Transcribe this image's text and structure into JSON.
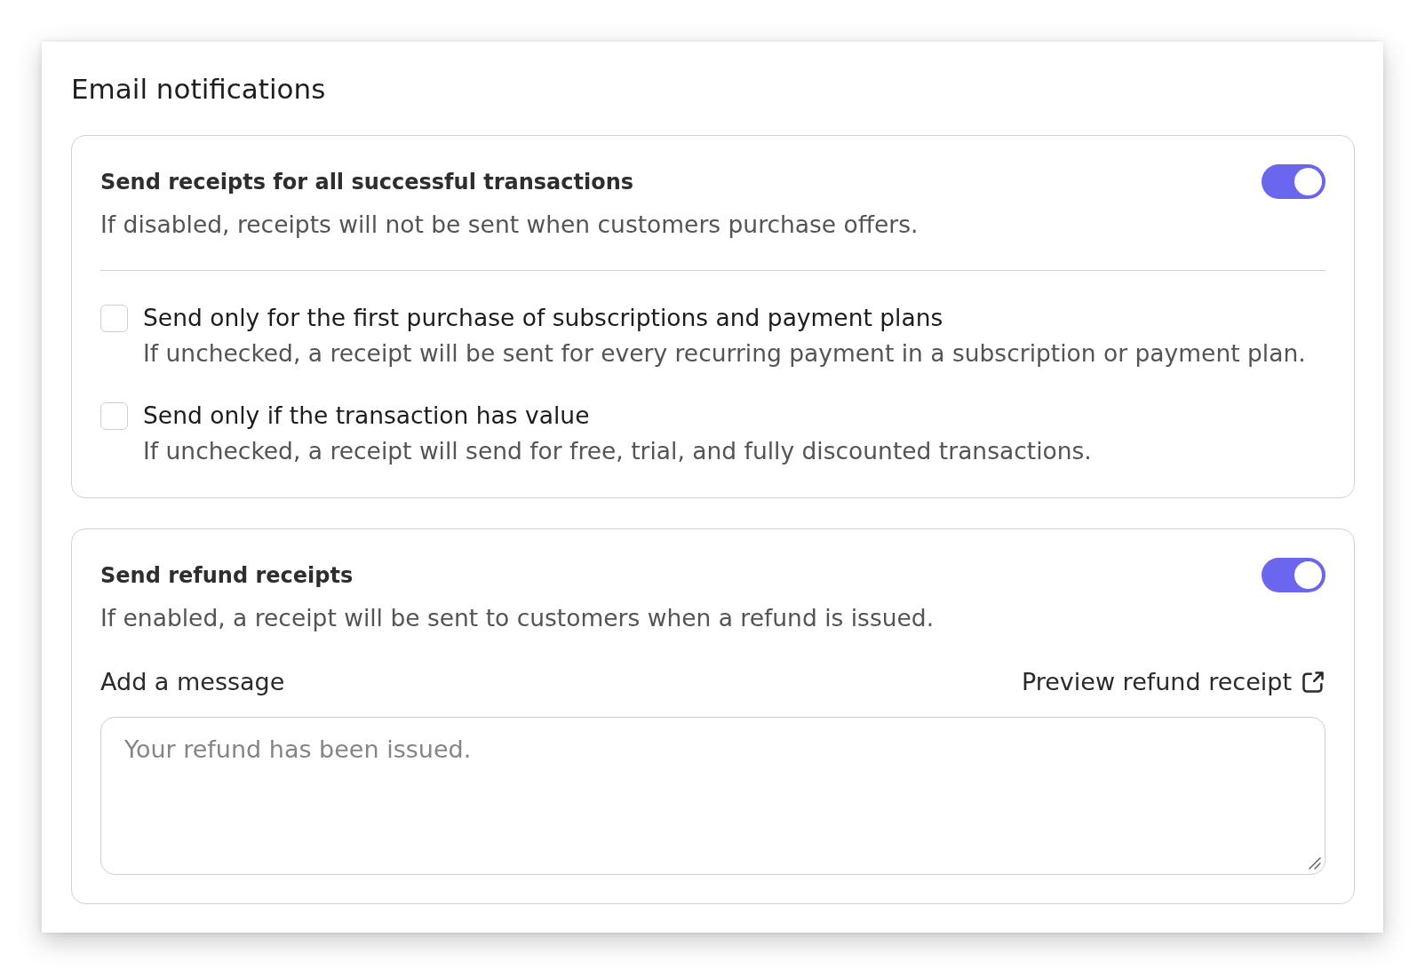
{
  "title": "Email notifications",
  "transaction_receipts": {
    "heading": "Send receipts for all successful transactions",
    "on": true,
    "description": "If disabled, receipts will not be sent when customers purchase offers.",
    "options": [
      {
        "label": "Send only for the first purchase of subscriptions and payment plans",
        "description": "If unchecked, a receipt will be sent for every recurring payment in a subscription or payment plan.",
        "checked": false
      },
      {
        "label": "Send only if the transaction has value",
        "description": "If unchecked, a receipt will send for free, trial, and fully discounted transactions.",
        "checked": false
      }
    ]
  },
  "refund_receipts": {
    "heading": "Send refund receipts",
    "on": true,
    "description": "If enabled, a receipt will be sent to customers when a refund is issued.",
    "message": {
      "label": "Add a message",
      "link": "Preview refund receipt",
      "placeholder": "Your refund has been issued."
    }
  }
}
